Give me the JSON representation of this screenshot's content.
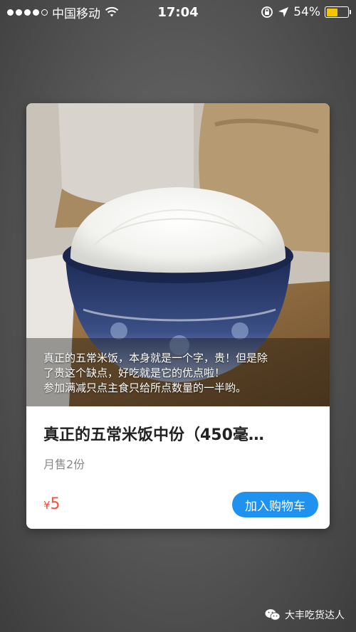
{
  "status_bar": {
    "carrier": "中国移动",
    "time": "17:04",
    "battery_percent": "54%",
    "battery_level": 0.54,
    "signal_bars_filled": 4,
    "signal_bars_total": 5
  },
  "product": {
    "image_icon": "rice-bowl-photo",
    "caption_lines": [
      "真正的五常米饭，本身就是一个字，贵！但是除",
      "了贵这个缺点，好吃就是它的优点啦！",
      "参加满减只点主食只给所点数量的一半哟。"
    ],
    "name": "真正的五常米饭中份（450毫…",
    "monthly_sales": "月售2份",
    "price_currency": "¥",
    "price_value": "5",
    "add_to_cart_label": "加入购物车"
  },
  "watermark": {
    "text": "大丰吃货达人",
    "icon": "wechat-icon"
  },
  "colors": {
    "accent": "#1f92f0",
    "price": "#f5503c",
    "battery": "#f5c400"
  }
}
